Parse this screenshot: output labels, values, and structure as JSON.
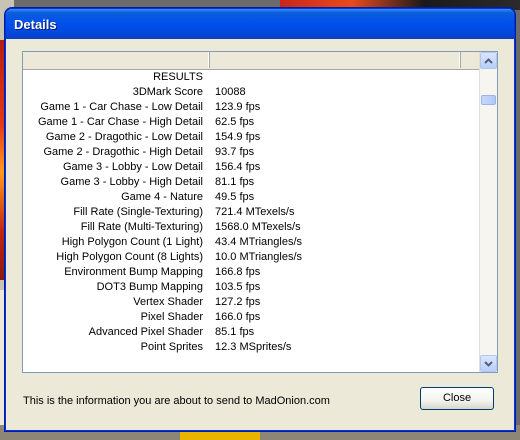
{
  "window": {
    "title": "Details"
  },
  "list": {
    "rows": [
      {
        "label": "RESULTS",
        "value": ""
      },
      {
        "label": "3DMark Score",
        "value": "10088"
      },
      {
        "label": "Game 1 - Car Chase - Low Detail",
        "value": "123.9 fps"
      },
      {
        "label": "Game 1 - Car Chase - High Detail",
        "value": "62.5 fps"
      },
      {
        "label": "Game 2 - Dragothic - Low Detail",
        "value": "154.9 fps"
      },
      {
        "label": "Game 2 - Dragothic - High Detail",
        "value": "93.7 fps"
      },
      {
        "label": "Game 3 - Lobby - Low Detail",
        "value": "156.4 fps"
      },
      {
        "label": "Game 3 - Lobby - High Detail",
        "value": "81.1 fps"
      },
      {
        "label": "Game 4 - Nature",
        "value": "49.5 fps"
      },
      {
        "label": "Fill Rate (Single-Texturing)",
        "value": "721.4 MTexels/s"
      },
      {
        "label": "Fill Rate (Multi-Texturing)",
        "value": "1568.0 MTexels/s"
      },
      {
        "label": "High Polygon Count (1 Light)",
        "value": "43.4 MTriangles/s"
      },
      {
        "label": "High Polygon Count (8 Lights)",
        "value": "10.0 MTriangles/s"
      },
      {
        "label": "Environment Bump Mapping",
        "value": "166.8 fps"
      },
      {
        "label": "DOT3 Bump Mapping",
        "value": "103.5 fps"
      },
      {
        "label": "Vertex Shader",
        "value": "127.2 fps"
      },
      {
        "label": "Pixel Shader",
        "value": "166.0 fps"
      },
      {
        "label": "Advanced Pixel Shader",
        "value": "85.1 fps"
      },
      {
        "label": "Point Sprites",
        "value": "12.3 MSprites/s"
      }
    ]
  },
  "footer": {
    "info_text": "This is the information you are about to send to MadOnion.com",
    "close_label": "Close"
  },
  "colors": {
    "titlebar": "#0050ee",
    "window_bg": "#ece9d8",
    "list_border": "#7f9db9"
  },
  "icons": {
    "scroll_up": "chevron-up-icon",
    "scroll_down": "chevron-down-icon"
  }
}
